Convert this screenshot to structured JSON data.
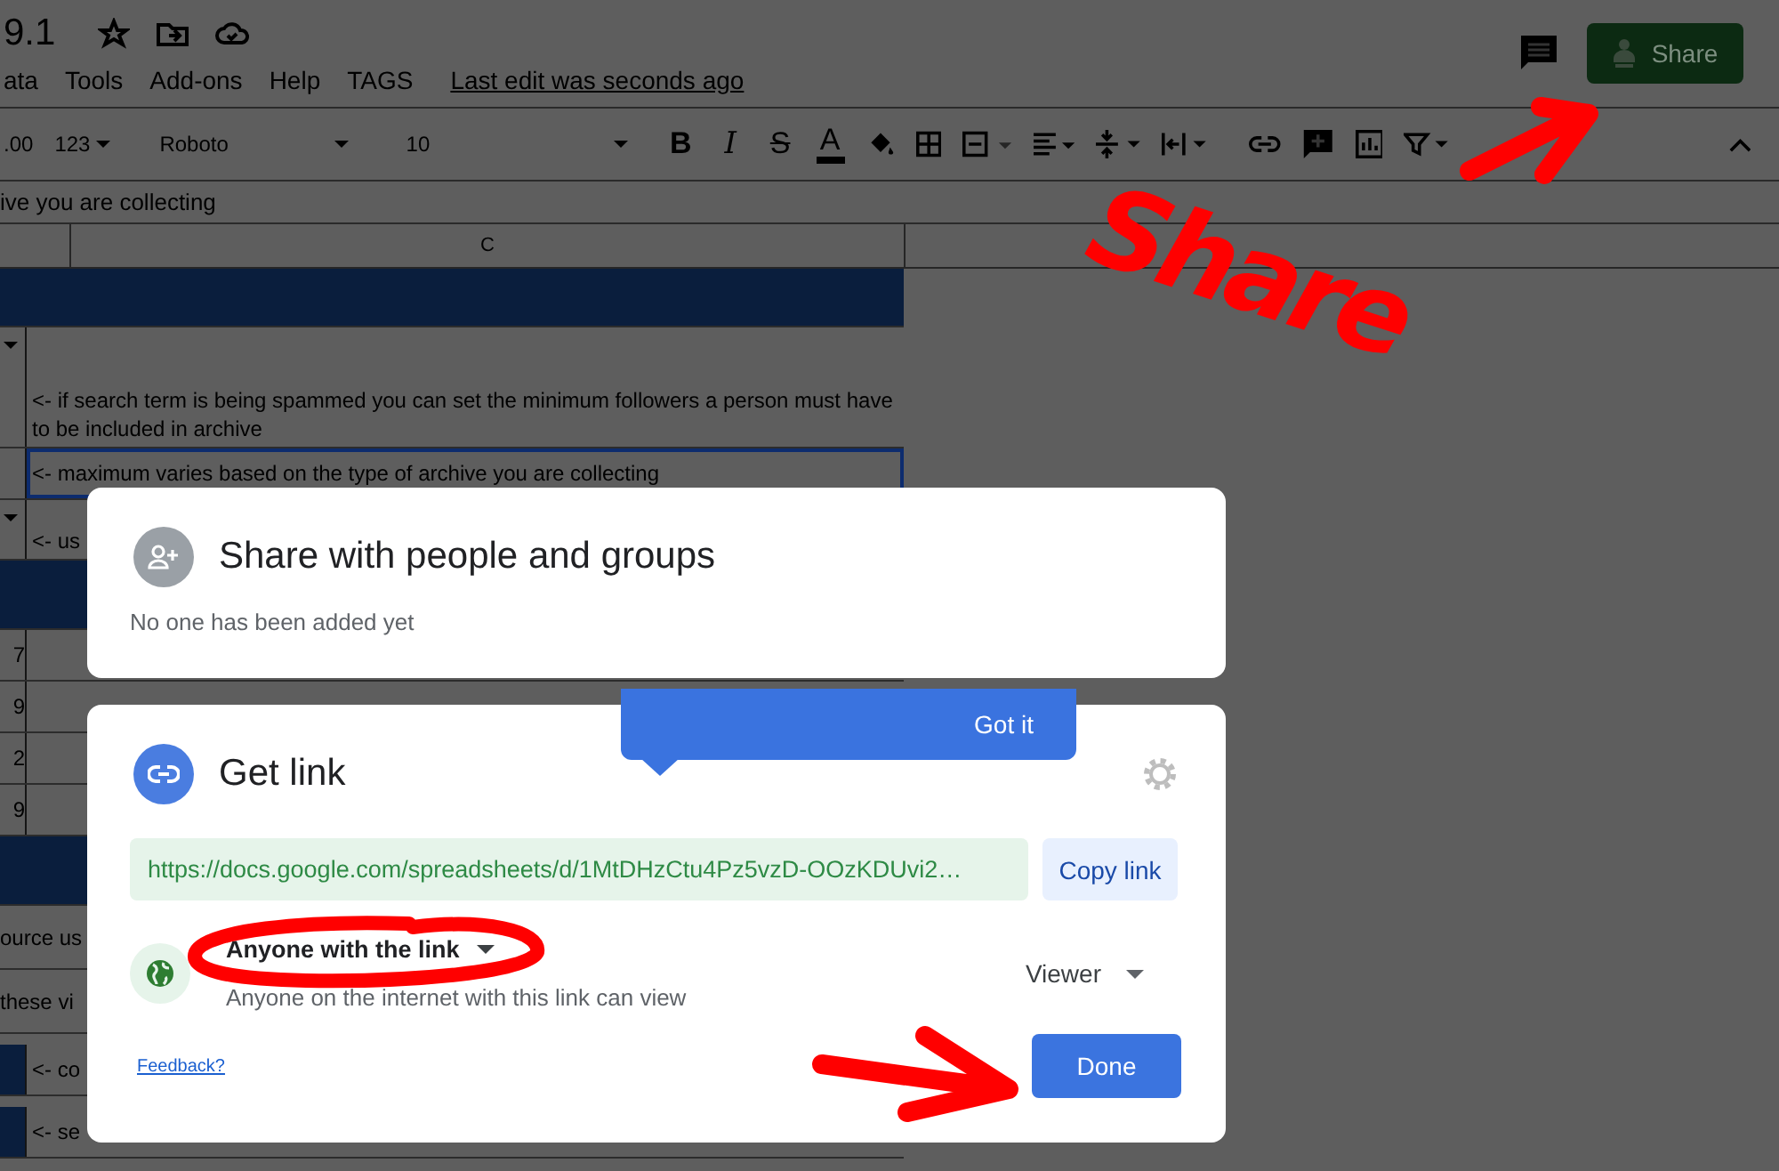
{
  "doc": {
    "title": "9.1",
    "last_edit": "Last edit was seconds ago"
  },
  "menu": [
    "ata",
    "Tools",
    "Add-ons",
    "Help",
    "TAGS"
  ],
  "share_button": {
    "label": "Share"
  },
  "toolbar": {
    "decimal": ".00",
    "format": "123",
    "font": "Roboto",
    "size": "10",
    "styles": [
      "B",
      "I",
      "S",
      "A"
    ]
  },
  "formula": "ive you are collecting",
  "sheet": {
    "column": "C",
    "rows": [
      {
        "kind": "header"
      },
      {
        "kind": "dropdown",
        "text": "<- if search term is being spammed you can set the minimum followers a person must have to be included in archive",
        "selected": false
      },
      {
        "kind": "note",
        "text": "<- maximum varies based on the type of archive you are collecting",
        "selected": true
      },
      {
        "kind": "dropdown",
        "text": "<- us",
        "selected": false
      },
      {
        "kind": "header"
      },
      {
        "kind": "number",
        "lead": "7",
        "selected": false
      },
      {
        "kind": "number",
        "lead": "9",
        "selected": false
      },
      {
        "kind": "number",
        "lead": "2",
        "selected": false
      },
      {
        "kind": "number",
        "lead": "9",
        "selected": false
      },
      {
        "kind": "header"
      },
      {
        "kind": "plain",
        "text": "ource us",
        "selected": false
      },
      {
        "kind": "plain",
        "text": "these vi",
        "selected": false
      },
      {
        "kind": "tagged",
        "text": "<- co",
        "selected": false
      },
      {
        "kind": "tagged",
        "text": "<- se",
        "selected": false
      }
    ]
  },
  "share_card": {
    "title": "Share with people and groups",
    "subtitle": "No one has been added yet"
  },
  "link_card": {
    "title": "Get link",
    "url": "https://docs.google.com/spreadsheets/d/1MtDHzCtu4Pz5vzD-OOzKDUvi2…",
    "copy": "Copy link",
    "access": "Anyone with the link",
    "access_note": "Anyone on the internet with this link can view",
    "role": "Viewer",
    "feedback": "Feedback?",
    "done": "Done"
  },
  "tooltip": {
    "action": "Got it"
  },
  "annotation": {
    "text": "Share"
  }
}
